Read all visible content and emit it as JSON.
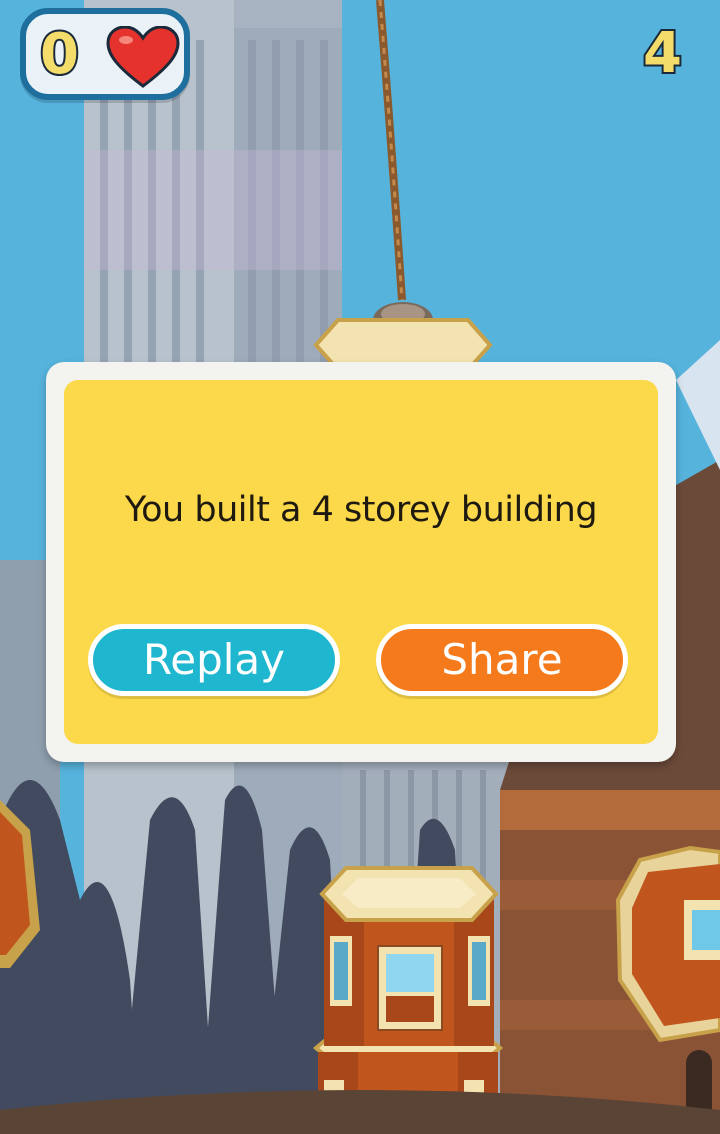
{
  "hud": {
    "lives": "0",
    "score": "4"
  },
  "dialog": {
    "message": "You built a 4 storey building",
    "replay_label": "Replay",
    "share_label": "Share"
  },
  "colors": {
    "sky": "#56b3dc",
    "dialog_fill": "#fcd94a",
    "replay_button": "#1fb7cf",
    "share_button": "#f57a1c",
    "heart": "#e5322d"
  }
}
